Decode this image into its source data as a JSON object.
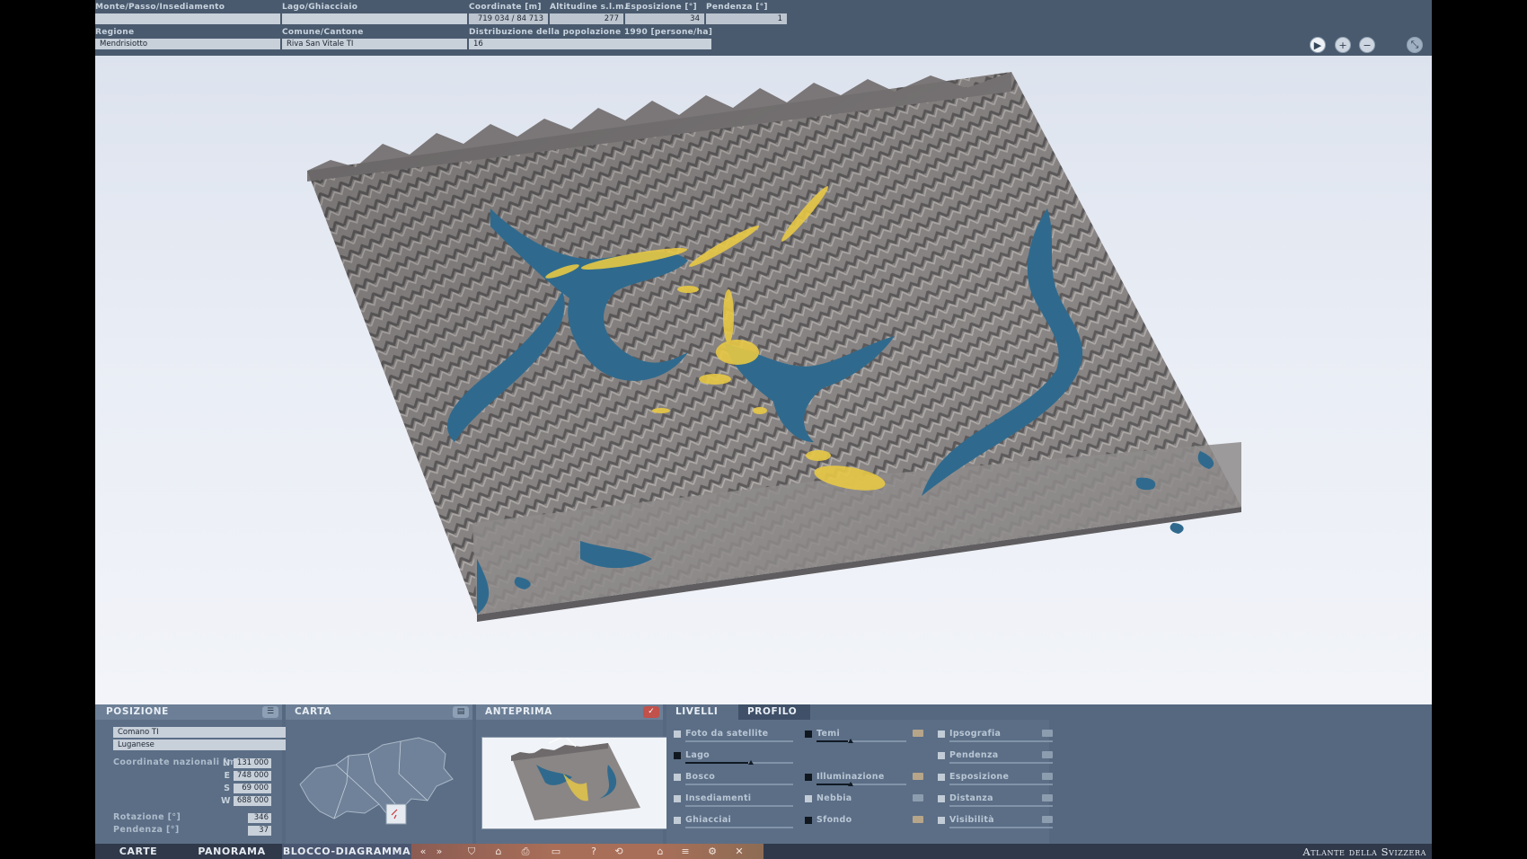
{
  "info_bar": {
    "mountain_label": "Monte/Passo/Insediamento",
    "mountain_value": "",
    "lake_label": "Lago/Ghiacciaio",
    "lake_value": "",
    "coords_label": "Coordinate [m]",
    "coords_value": "719 034 / 84 713",
    "altitude_label": "Altitudine s.l.m.",
    "altitude_value": "277",
    "exposure_label": "Esposizione [°]",
    "exposure_value": "34",
    "slope_label": "Pendenza [°]",
    "slope_value": "1",
    "region_label": "Regione",
    "region_value": "Mendrisiotto",
    "commune_label": "Comune/Cantone",
    "commune_value": "Riva San Vitale   TI",
    "population_label": "Distribuzione della popolazione 1990 [persone/ha]",
    "population_value": "16"
  },
  "view_controls": [
    {
      "icon": "play-icon",
      "glyph": "▶"
    },
    {
      "icon": "zoom-in-icon",
      "glyph": "+"
    },
    {
      "icon": "zoom-out-icon",
      "glyph": "−"
    },
    {
      "icon": "fullscreen-icon",
      "glyph": "⤡"
    }
  ],
  "panels": {
    "posizione": {
      "title": "POSIZIONE",
      "place_1": "Comano   TI",
      "place_2": "Luganese",
      "coords_label": "Coordinate nazionali [m]",
      "coords": [
        {
          "key": "N",
          "value": "131 000"
        },
        {
          "key": "E",
          "value": "748 000"
        },
        {
          "key": "S",
          "value": "69 000"
        },
        {
          "key": "W",
          "value": "688 000"
        }
      ],
      "rotation_label": "Rotazione [°]",
      "rotation_value": "346",
      "tilt_label": "Pendenza [°]",
      "tilt_value": "37"
    },
    "carta": {
      "title": "CARTA"
    },
    "anteprima": {
      "title": "ANTEPRIMA",
      "check_glyph": "✓"
    },
    "livelli": {
      "title": "LIVELLI",
      "tab_profilo": "PROFILO",
      "layers": [
        {
          "name": "Foto da satellite",
          "checked": false
        },
        {
          "name": "Lago",
          "checked": true
        },
        {
          "name": "Bosco",
          "checked": false
        },
        {
          "name": "Insediamenti",
          "checked": false
        },
        {
          "name": "Ghiacciai",
          "checked": false
        },
        {
          "name": "Temi",
          "checked": true
        },
        {
          "name": "Illuminazione",
          "checked": true
        },
        {
          "name": "Nebbia",
          "checked": false
        },
        {
          "name": "Sfondo",
          "checked": true
        },
        {
          "name": "Ipsografia",
          "checked": false
        },
        {
          "name": "Pendenza",
          "checked": false
        },
        {
          "name": "Esposizione",
          "checked": false
        },
        {
          "name": "Distanza",
          "checked": false
        },
        {
          "name": "Visibilità",
          "checked": false
        }
      ]
    }
  },
  "nav": {
    "carte": "CARTE",
    "panorama": "PANORAMA",
    "blocco": "BLOCCO-DIAGRAMMA",
    "tools": [
      "«",
      "»",
      "⛉",
      "⌂",
      "⎙",
      "▭",
      "?",
      "⟲",
      "⌂",
      "≡",
      "⚙",
      "✕"
    ],
    "brand": "Atlante della Svizzera"
  }
}
